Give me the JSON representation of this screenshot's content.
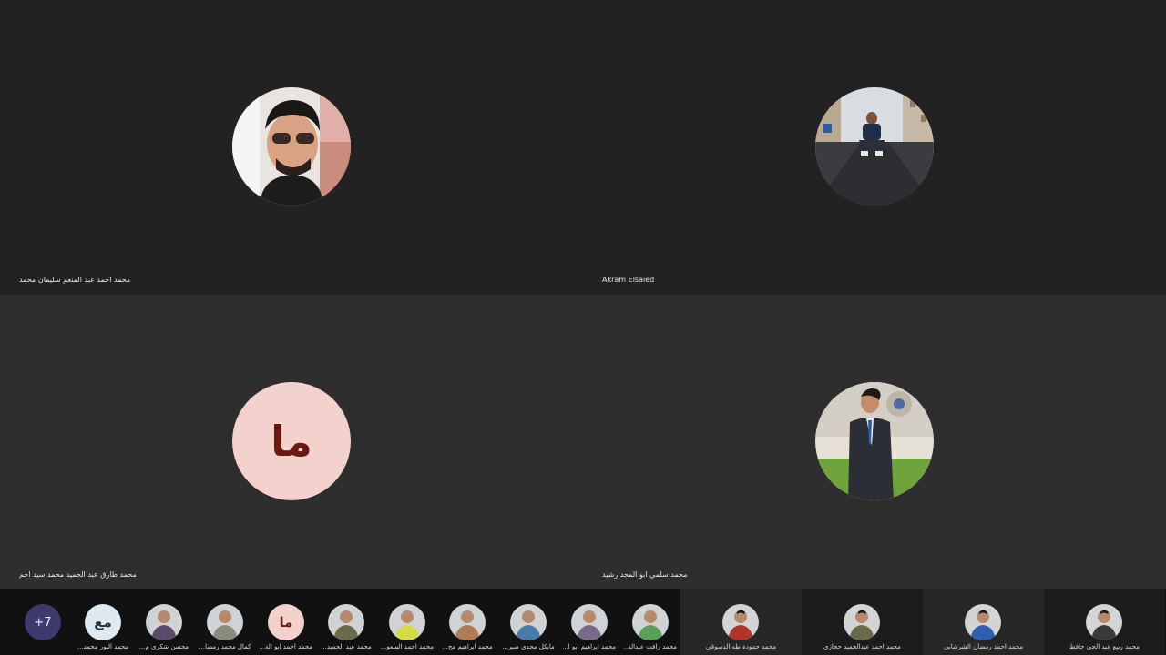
{
  "tiles": [
    {
      "name": "محمد احمد عبد المنعم سليمان محمد",
      "avatar": "photo-glasses"
    },
    {
      "name": "Akram Elsaied",
      "avatar": "photo-street"
    },
    {
      "name": "محمد طارق عبد الحميد محمد سيد احم",
      "avatar": "initials",
      "initials": "ما"
    },
    {
      "name": "محمد سلمي ابو المجد رشيد",
      "avatar": "photo-suit"
    }
  ],
  "strip": {
    "more_label": "+7",
    "small": [
      {
        "name": "محمد النور محمد...",
        "initials": "مع",
        "bg": "#dfe9ef",
        "fg": "#1c3140"
      },
      {
        "name": "محسن شكري م...",
        "photo": "#5a4a6a"
      },
      {
        "name": "كمال محمد رمضا...",
        "photo": "#8a8b7a"
      },
      {
        "name": "محمد احمد ابو الة...",
        "initials": "ما",
        "bg": "#f3d1cc",
        "fg": "#6b1a12"
      },
      {
        "name": "محمد عبد الحميد...",
        "photo": "#6b6a4a"
      },
      {
        "name": "محمد احمد السعو...",
        "photo": "#d6d94a"
      },
      {
        "name": "محمد ابراهيم مح...",
        "photo": "#b07a55"
      },
      {
        "name": "مايكل مجدي صبر...",
        "photo": "#4a7aa8"
      },
      {
        "name": "محمد ابراهيم ابو ا...",
        "photo": "#7a6a8a"
      },
      {
        "name": "محمد رافت عبدالة...",
        "photo": "#5aa05a"
      }
    ],
    "large": [
      {
        "name": "محمد حمودة طه الدسوقي",
        "photo": "#b0332c"
      },
      {
        "name": "محمد احمد عبدالحميد حجازي",
        "photo": "#6a6a4a"
      },
      {
        "name": "محمد احمد رمضان الشرشابي",
        "photo": "#2f5fb0"
      },
      {
        "name": "محمد ربيع عبد الحي حافظ",
        "photo": "#3a3a3a"
      }
    ]
  }
}
